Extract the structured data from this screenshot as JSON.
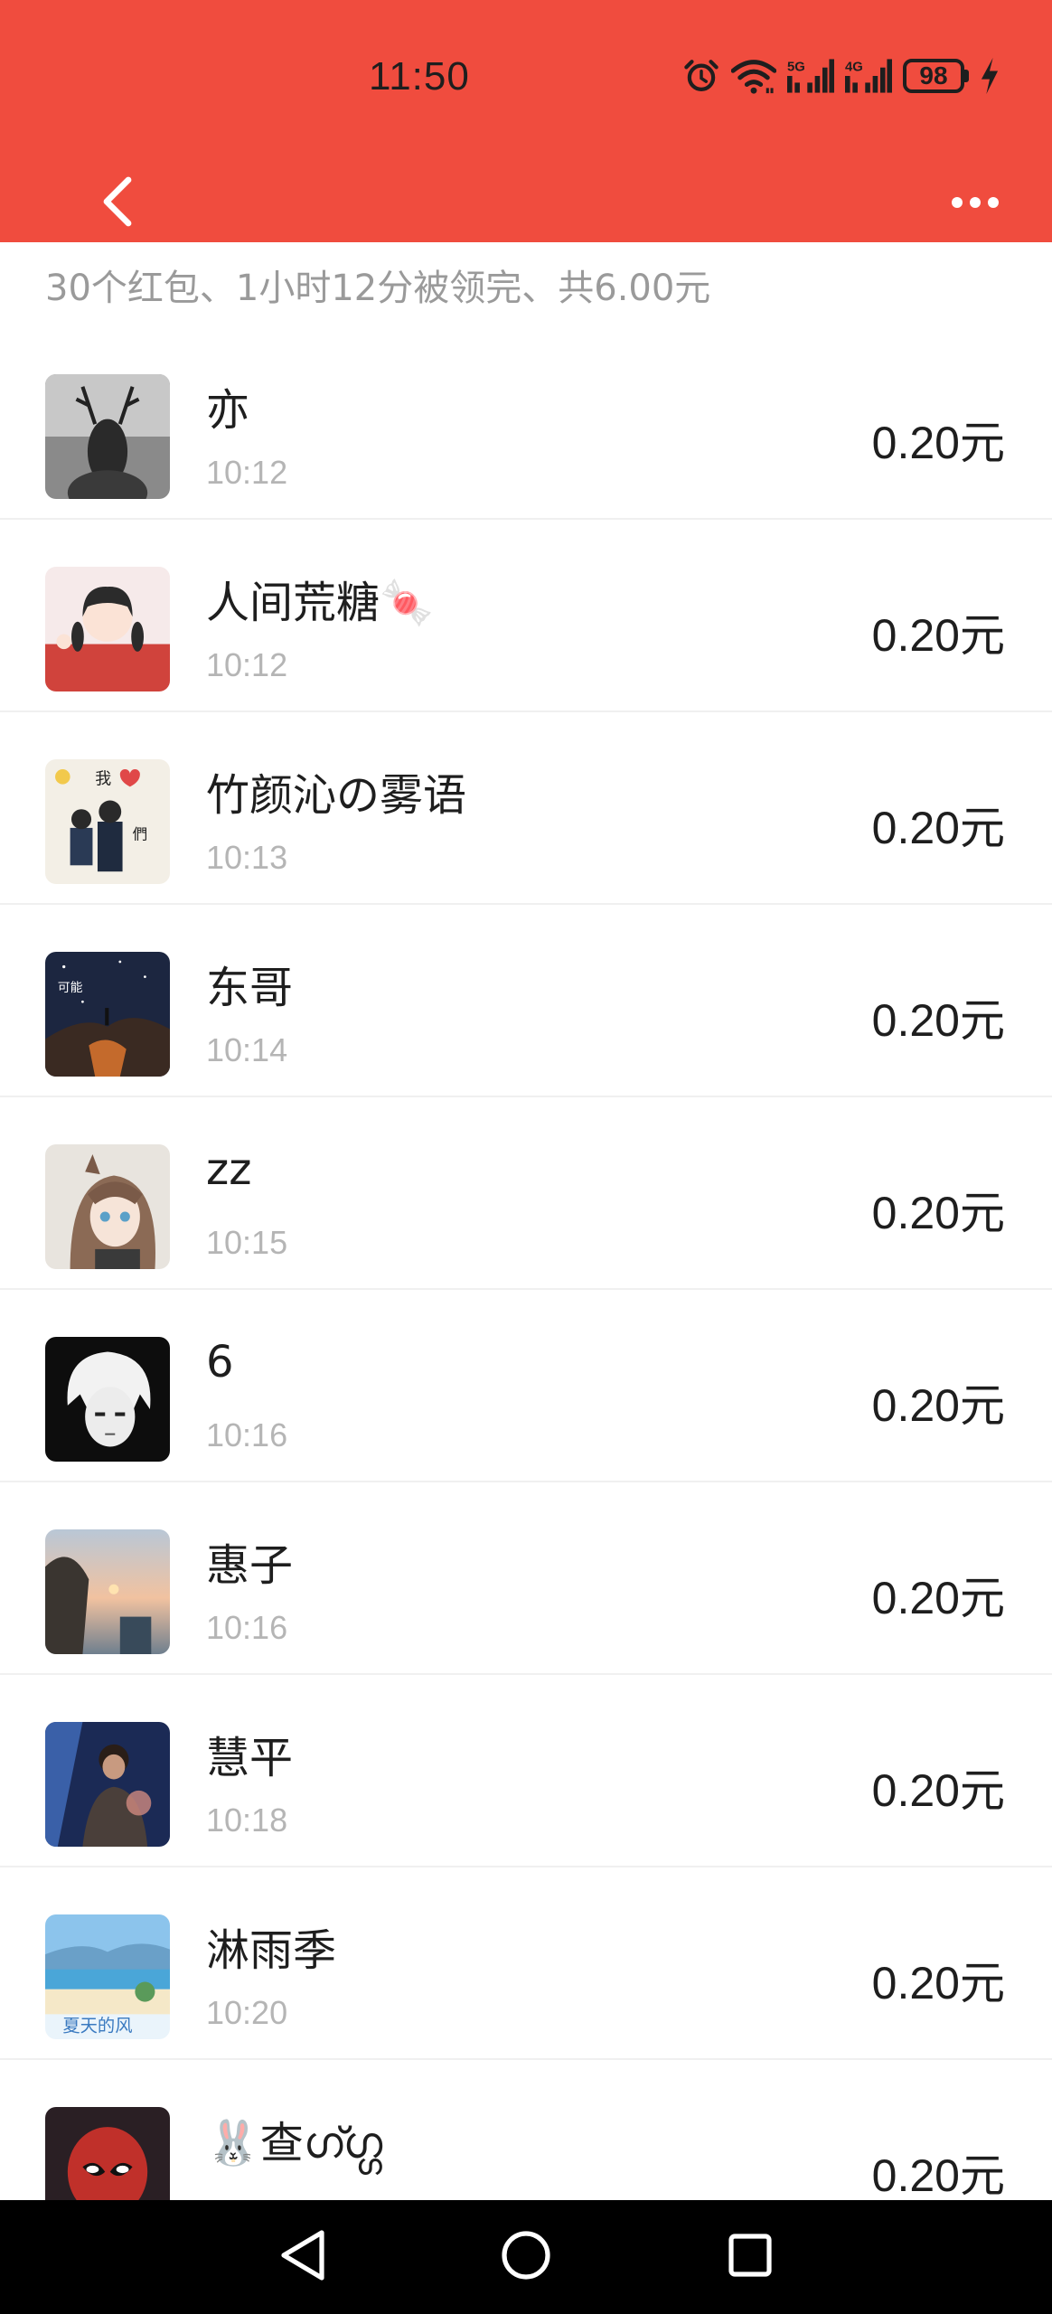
{
  "status_bar": {
    "time": "11:50",
    "battery": "98"
  },
  "summary": "30个红包、1小时12分被领完、共6.00元",
  "records": [
    {
      "name": "亦",
      "time": "10:12",
      "amount": "0.20",
      "unit": "元",
      "avatar": "deer-avatar"
    },
    {
      "name": "人间荒糖🍬",
      "time": "10:12",
      "amount": "0.20",
      "unit": "元",
      "avatar": "girl-avatar"
    },
    {
      "name": "竹颜沁の雾语",
      "time": "10:13",
      "amount": "0.20",
      "unit": "元",
      "avatar": "family-avatar"
    },
    {
      "name": "东哥",
      "time": "10:14",
      "amount": "0.20",
      "unit": "元",
      "avatar": "starry-night-avatar"
    },
    {
      "name": "zz",
      "time": "10:15",
      "amount": "0.20",
      "unit": "元",
      "avatar": "anime-girl-avatar"
    },
    {
      "name": "6",
      "time": "10:16",
      "amount": "0.20",
      "unit": "元",
      "avatar": "anime-boy-avatar"
    },
    {
      "name": "惠子",
      "time": "10:16",
      "amount": "0.20",
      "unit": "元",
      "avatar": "sunset-avatar"
    },
    {
      "name": "慧平",
      "time": "10:18",
      "amount": "0.20",
      "unit": "元",
      "avatar": "person-photo-avatar"
    },
    {
      "name": "淋雨季",
      "time": "10:20",
      "amount": "0.20",
      "unit": "元",
      "avatar": "summer-avatar"
    },
    {
      "name": "🐰查ഗ്ഗ്ഗ",
      "time": "",
      "amount": "0.20",
      "unit": "元",
      "avatar": "deadpool-avatar"
    }
  ],
  "colors": {
    "header": "#f04c3e",
    "name": "#1e1e1e",
    "time": "#b5b5b5",
    "summary": "#9a9a9a"
  },
  "icons": [
    "alarm-icon",
    "wifi-icon",
    "signal-5g-icon",
    "signal-4g-icon",
    "battery-icon",
    "charging-icon",
    "back-icon",
    "more-icon",
    "nav-back-icon",
    "nav-home-icon",
    "nav-recent-icon"
  ]
}
